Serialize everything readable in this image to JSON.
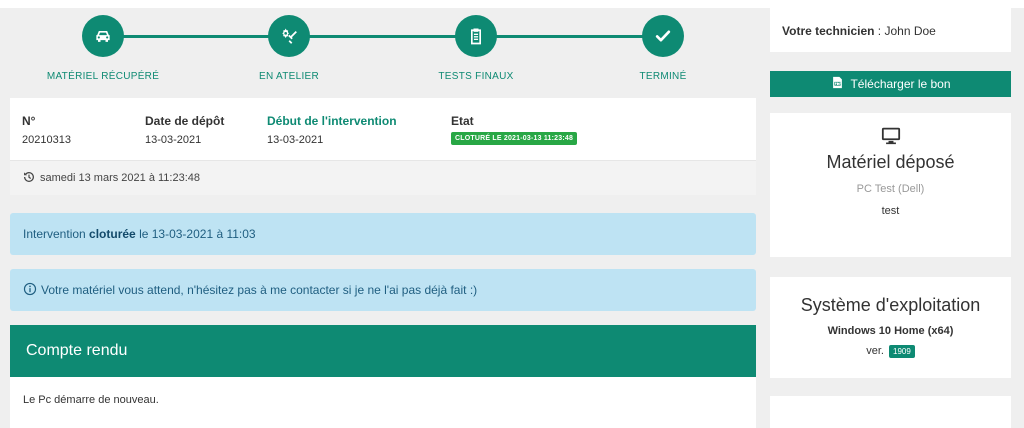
{
  "stepper": {
    "steps": [
      {
        "label": "MATÉRIEL RÉCUPÉRÉ",
        "icon": "car-icon"
      },
      {
        "label": "EN ATELIER",
        "icon": "tools-icon"
      },
      {
        "label": "TESTS FINAUX",
        "icon": "clipboard-icon"
      },
      {
        "label": "TERMINÉ",
        "icon": "check-icon"
      }
    ]
  },
  "info": {
    "numero_label": "N°",
    "numero_value": "20210313",
    "depot_label": "Date de dépôt",
    "depot_value": "13-03-2021",
    "debut_label": "Début de l'intervention",
    "debut_value": "13-03-2021",
    "etat_label": "Etat",
    "etat_badge": "CLOTURÉ LE 2021-03-13 11:23:48",
    "timestamp": "samedi 13 mars 2021 à 11:23:48"
  },
  "alerts": {
    "cloture_prefix": "Intervention ",
    "cloture_bold": "cloturée",
    "cloture_suffix": " le 13-03-2021 à 11:03",
    "info_text": "Votre matériel vous attend, n'hésitez pas à me contacter si je ne l'ai pas déjà fait :)"
  },
  "compte_rendu": {
    "title": "Compte rendu",
    "body": "Le Pc démarre de nouveau."
  },
  "sidebar": {
    "tech_label": "Votre technicien",
    "tech_sep": " : ",
    "tech_name": "John Doe",
    "download_label": "Télécharger le bon",
    "materiel_title": "Matériel déposé",
    "materiel_name": "PC Test (Dell)",
    "materiel_desc": "test",
    "os_title": "Système d'exploitation",
    "os_name": "Windows 10 Home (x64)",
    "os_ver_label": "ver.",
    "os_ver_value": "1909"
  },
  "colors": {
    "accent": "#0e8a73",
    "success": "#28a745",
    "alert_bg": "#bee3f3"
  }
}
